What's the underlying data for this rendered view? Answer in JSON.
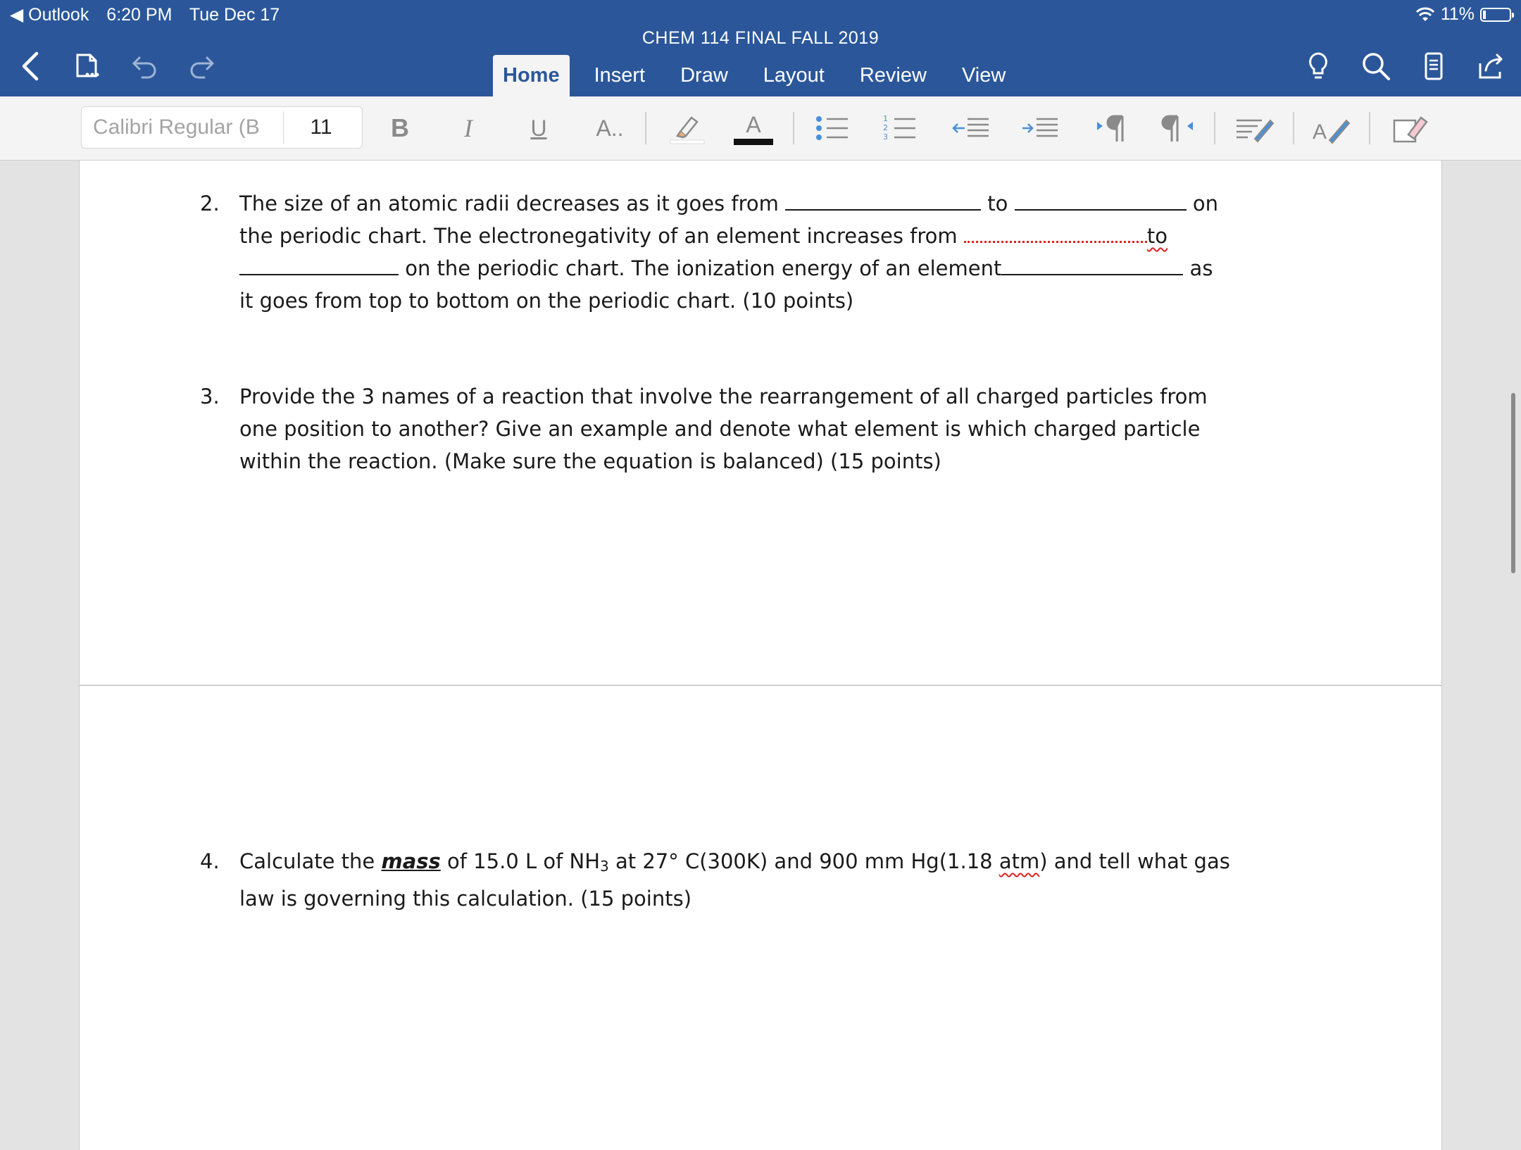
{
  "status_bar": {
    "back_app": "◀ Outlook",
    "time": "6:20 PM",
    "date": "Tue Dec 17",
    "battery": "11%"
  },
  "document_title": "CHEM 114 FINAL FALL 2019",
  "tabs": [
    {
      "label": "Home",
      "active": true
    },
    {
      "label": "Insert",
      "active": false
    },
    {
      "label": "Draw",
      "active": false
    },
    {
      "label": "Layout",
      "active": false
    },
    {
      "label": "Review",
      "active": false
    },
    {
      "label": "View",
      "active": false
    }
  ],
  "ribbon": {
    "font_name": "Calibri Regular (B",
    "font_size": "11",
    "bold_label": "B",
    "italic_label": "I",
    "underline_label": "U",
    "font_effects_label": "A..",
    "font_color_label": "A"
  },
  "questions": [
    {
      "number": "2.",
      "lines": [
        {
          "segments": [
            "The size of an atomic radii decreases as it goes from ",
            " to ",
            " on"
          ]
        },
        {
          "segments": [
            "the periodic chart.  The electronegativity of an element increases from ",
            "to"
          ]
        },
        {
          "segments": [
            " on the periodic chart.  The ionization energy of an element",
            " as"
          ]
        },
        {
          "segments": [
            "it goes from top to bottom on the periodic chart. (10 points)"
          ]
        }
      ]
    },
    {
      "number": "3.",
      "lines": [
        "Provide the 3 names of a reaction that involve the rearrangement of all charged particles from",
        "one position to another?  Give an example and denote what element is which charged particle",
        "within the reaction. (Make sure the equation is balanced) (15 points)"
      ]
    },
    {
      "number": "4.",
      "line1": {
        "pre": "Calculate the ",
        "emph": "mass",
        "mid": " of 15.0 L of NH",
        "sub": "3",
        "post": " at 27° C(300K) and 900 mm Hg(1.18 ",
        "squiggle": "atm",
        "end": ") and tell what gas"
      },
      "line2": "law is governing this calculation. (15 points)"
    }
  ],
  "colors": {
    "brand": "#2b579a",
    "ribbon": "#f4f4f4",
    "canvas": "#e3e3e3",
    "spellcheck": "#dd2222"
  }
}
